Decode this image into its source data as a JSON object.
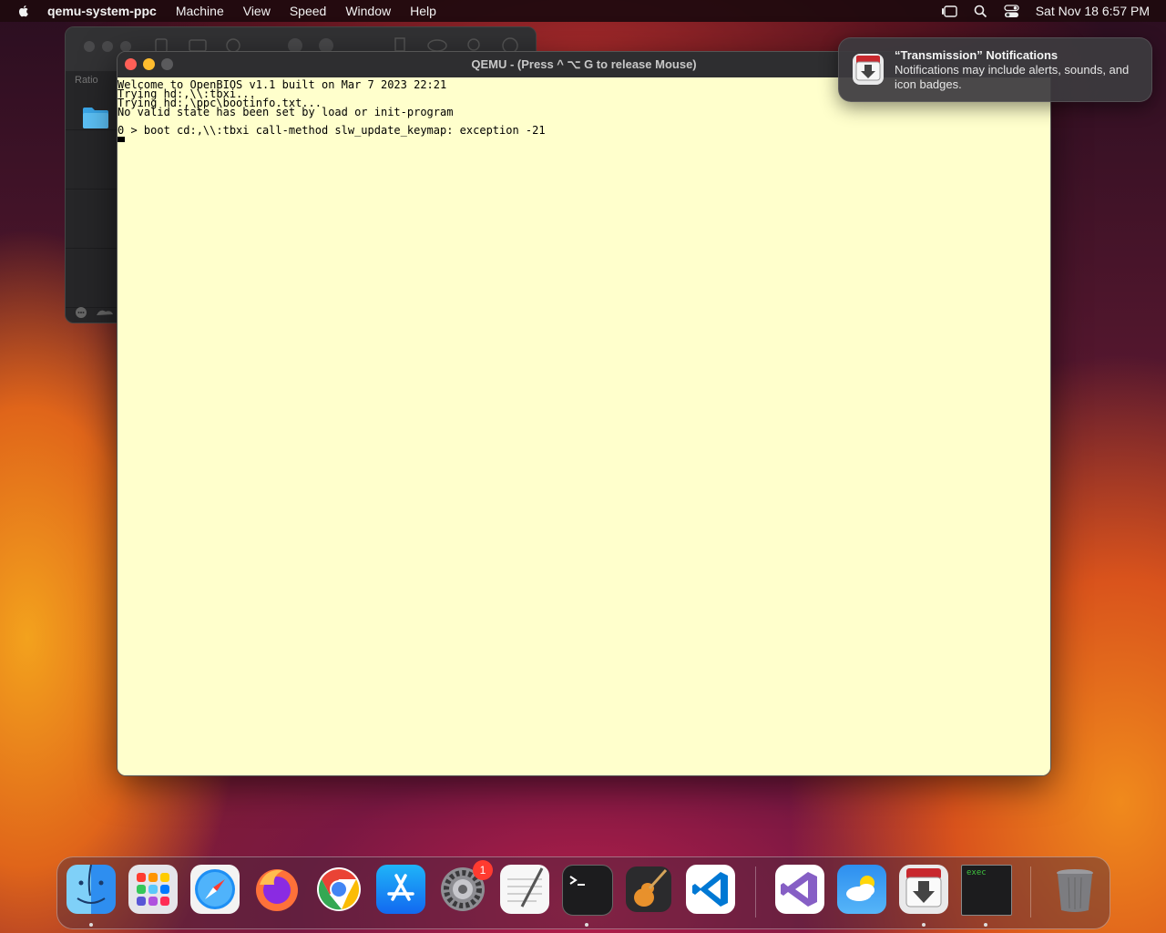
{
  "menubar": {
    "app_name": "qemu-system-ppc",
    "menus": [
      "Machine",
      "View",
      "Speed",
      "Window",
      "Help"
    ],
    "clock": "Sat Nov 18  6:57 PM"
  },
  "background_window": {
    "sidebar_label": "Ratio"
  },
  "qemu_window": {
    "title": "QEMU - (Press  ^ ⌥ G  to release Mouse)",
    "console_lines": [
      "Welcome to OpenBIOS v1.1 built on Mar 7 2023 22:21",
      "Trying hd:,\\\\:tbxi...",
      "Trying hd:,\\ppc\\bootinfo.txt...",
      "No valid state has been set by load or init-program"
    ],
    "prompt_line": "0 > boot cd:,\\\\:tbxi call-method slw_update_keymap: exception -21"
  },
  "notification": {
    "title": "“Transmission” Notifications",
    "body": "Notifications may include alerts, sounds, and icon badges."
  },
  "dock": {
    "settings_badge": "1",
    "terminal_label": "exec",
    "items": [
      "Finder",
      "Launchpad",
      "Safari",
      "Firefox",
      "Chrome",
      "App Store",
      "System Settings",
      "TextEdit",
      "Terminal",
      "GarageBand",
      "Visual Studio Code",
      "Visual Studio",
      "Weather",
      "Transmission",
      "exec",
      "Trash"
    ]
  }
}
